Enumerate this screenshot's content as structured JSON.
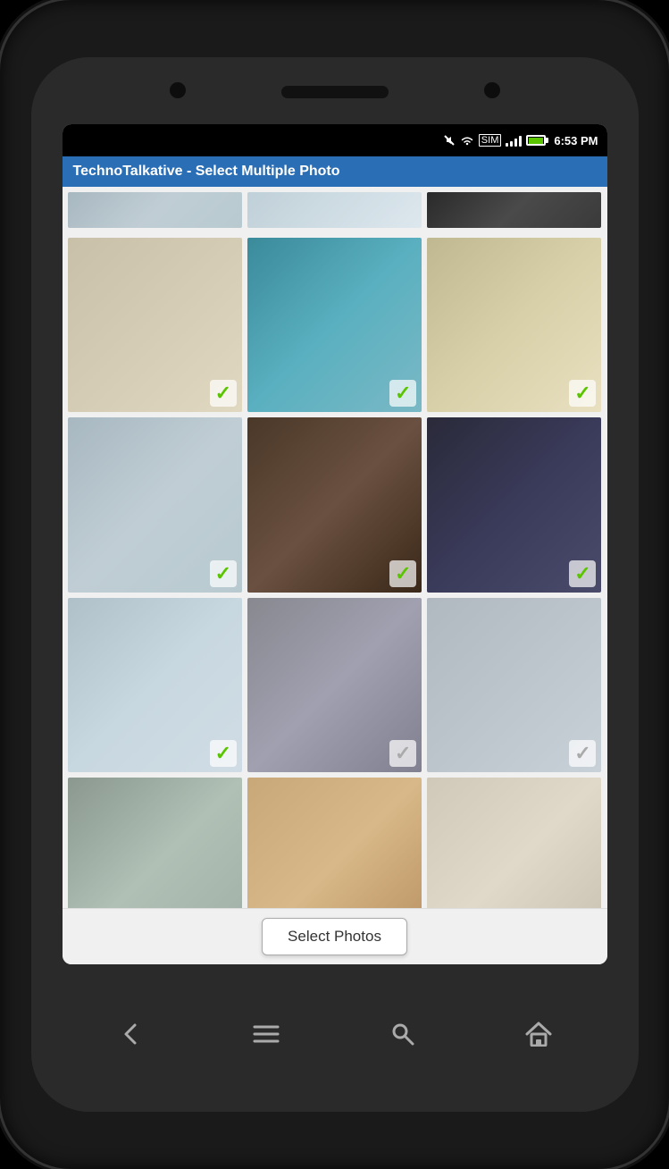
{
  "phone": {
    "status_bar": {
      "time": "6:53 PM",
      "icons": [
        "mute",
        "wifi",
        "sim",
        "signal",
        "battery"
      ]
    },
    "app_header": {
      "title": "TechnoTalkative - Select Multiple Photo"
    },
    "photos": [
      {
        "id": 1,
        "style": "photo-1",
        "selected": true,
        "check": "green"
      },
      {
        "id": 2,
        "style": "photo-2",
        "selected": true,
        "check": "green"
      },
      {
        "id": 3,
        "style": "photo-3",
        "selected": true,
        "check": "green"
      },
      {
        "id": 4,
        "style": "photo-4",
        "selected": true,
        "check": "green"
      },
      {
        "id": 5,
        "style": "photo-5",
        "selected": true,
        "check": "green"
      },
      {
        "id": 6,
        "style": "photo-6",
        "selected": true,
        "check": "green"
      },
      {
        "id": 7,
        "style": "photo-7",
        "selected": true,
        "check": "green"
      },
      {
        "id": 8,
        "style": "photo-8",
        "selected": true,
        "check": "green"
      },
      {
        "id": 9,
        "style": "photo-9",
        "selected": true,
        "check": "green"
      },
      {
        "id": 10,
        "style": "photo-10",
        "selected": true,
        "check": "green"
      },
      {
        "id": 11,
        "style": "photo-11",
        "selected": false,
        "check": "gray"
      },
      {
        "id": 12,
        "style": "photo-12",
        "selected": false,
        "check": "gray"
      },
      {
        "id": 13,
        "style": "photo-13",
        "selected": false,
        "check": "gray"
      },
      {
        "id": 14,
        "style": "photo-14",
        "selected": false,
        "check": "gray"
      },
      {
        "id": 15,
        "style": "photo-15",
        "selected": false,
        "check": "gray"
      }
    ],
    "button": {
      "label": "Select Photos"
    },
    "nav": {
      "back_label": "←",
      "menu_label": "≡",
      "search_label": "⌕",
      "home_label": "⌂"
    }
  }
}
